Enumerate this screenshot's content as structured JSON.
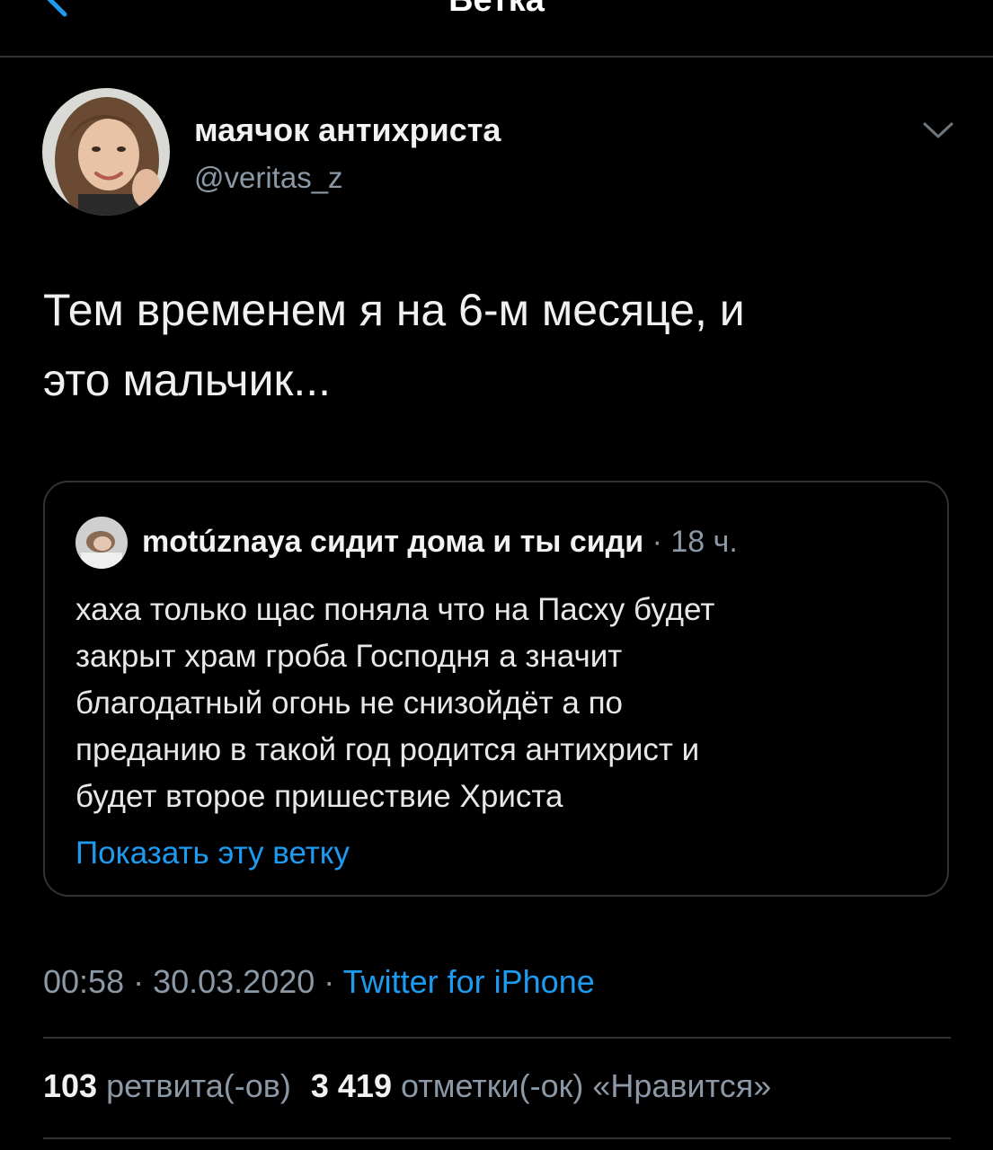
{
  "nav": {
    "title": "Ветка"
  },
  "author": {
    "display_name": "маячок антихриста",
    "handle": "@veritas_z"
  },
  "tweet": {
    "text": "Тем временем я на 6-м месяце, и\nэто мальчик..."
  },
  "quote": {
    "name": "motúznaya сидит дома и ты сиди",
    "time": " · 18 ч.",
    "text": "хаха только щас поняла что на Пасху будет\nзакрыт храм гроба Господня а значит\nблагодатный огонь не снизойдёт а по\nпреданию в такой год родится антихрист и\nбудет второе пришествие Христа",
    "show_thread": "Показать эту ветку"
  },
  "meta": {
    "time": "00:58",
    "sep1": " · ",
    "date": "30.03.2020",
    "sep2": " · ",
    "source": "Twitter for iPhone"
  },
  "stats": {
    "retweets_count": "103",
    "retweets_label": " ретвита(-ов)",
    "likes_count": "3 419",
    "likes_label": " отметки(-ок) «Нравится»"
  },
  "colors": {
    "background": "#000000",
    "accent": "#1d9bf0",
    "secondary_text": "#8b98a5",
    "border": "#2f3336"
  },
  "icons": {
    "back": "chevron-left-icon",
    "more": "chevron-down-icon"
  }
}
